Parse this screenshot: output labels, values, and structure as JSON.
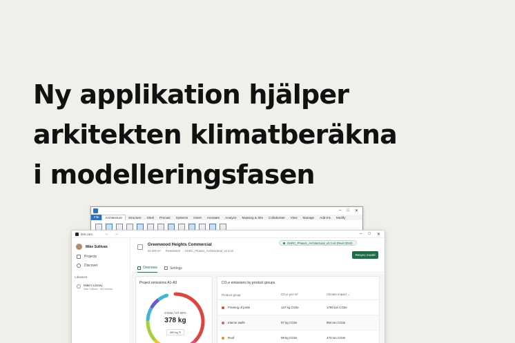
{
  "headline": {
    "lines": [
      "Ny applikation hjälper",
      "arkitekten klimatberäkna",
      "i modelleringsfasen"
    ]
  },
  "revit": {
    "tabs": [
      "File",
      "Architecture",
      "Structure",
      "Steel",
      "Precast",
      "Systems",
      "Insert",
      "Annotate",
      "Analyze",
      "Massing & Site",
      "Collaborate",
      "View",
      "Manage",
      "Add-Ins",
      "Modify"
    ]
  },
  "app": {
    "window_title": "lem.com",
    "user_name": "Mike Sullivan",
    "nav": {
      "projects": "Projects",
      "discover": "Discover"
    },
    "libraries_heading": "Libraries",
    "library": {
      "name": "Mike's Library",
      "meta": "Mike Sullivan · 300 families"
    },
    "project": {
      "title": "Greenwood Heights Commercial",
      "area": "20 000 m²",
      "type": "Residential",
      "file": "GHRC_Phase1_Architectural_v2.3.rvt"
    },
    "file_chip": "GHRC_Phase1_Architectural_v2.3.rvt (Revit 2024)",
    "resync_label": "Resync model",
    "tabs": {
      "overview": "Overview",
      "settings": "Settings"
    },
    "emissions_card": {
      "title": "Project emissions A1-A3",
      "label": "CO2e / m² GFA",
      "value": "378 kg",
      "sub_value": "400 kg"
    },
    "groups_card": {
      "title": "CO₂e emissions by product groups",
      "headers": {
        "group": "Product group",
        "per_m2": "CO₂e per m²",
        "impact": "Climate impact"
      },
      "rows": [
        {
          "group": "Framing of joists",
          "per_m2": "127 kg CO2e",
          "impact": "1750 ton CO2e",
          "color": "#e0443c"
        },
        {
          "group": "Interior walls",
          "per_m2": "97 kg CO2e",
          "impact": "964 ton CO2e",
          "color": "#e34f8a"
        },
        {
          "group": "Roof",
          "per_m2": "59 kg CO2e",
          "impact": "473 ton CO2e",
          "color": "#f08a24"
        }
      ]
    },
    "donut_colors": [
      "#e0443c",
      "#e34f8a",
      "#f08a24",
      "#f2c230",
      "#a6cf3c",
      "#3fb6d8",
      "#6b59d3"
    ]
  }
}
